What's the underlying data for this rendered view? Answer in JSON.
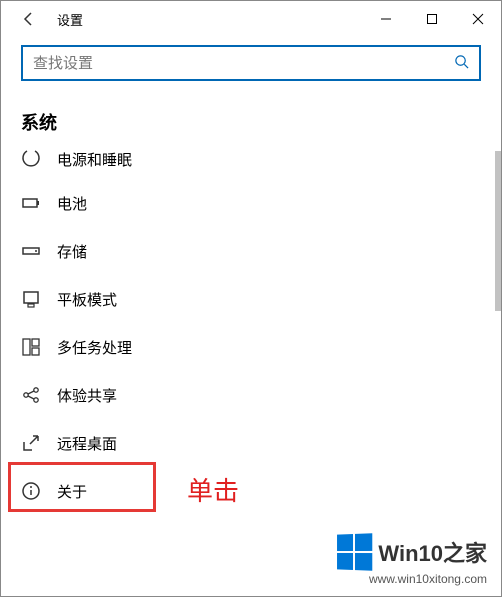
{
  "window": {
    "title": "设置"
  },
  "search": {
    "placeholder": "查找设置"
  },
  "section": {
    "title": "系统"
  },
  "nav": {
    "items": [
      {
        "label": "电源和睡眠"
      },
      {
        "label": "电池"
      },
      {
        "label": "存储"
      },
      {
        "label": "平板模式"
      },
      {
        "label": "多任务处理"
      },
      {
        "label": "体验共享"
      },
      {
        "label": "远程桌面"
      },
      {
        "label": "关于"
      }
    ]
  },
  "annotation": {
    "click": "单击"
  },
  "branding": {
    "text": "Win10之家",
    "url": "www.win10xitong.com"
  }
}
